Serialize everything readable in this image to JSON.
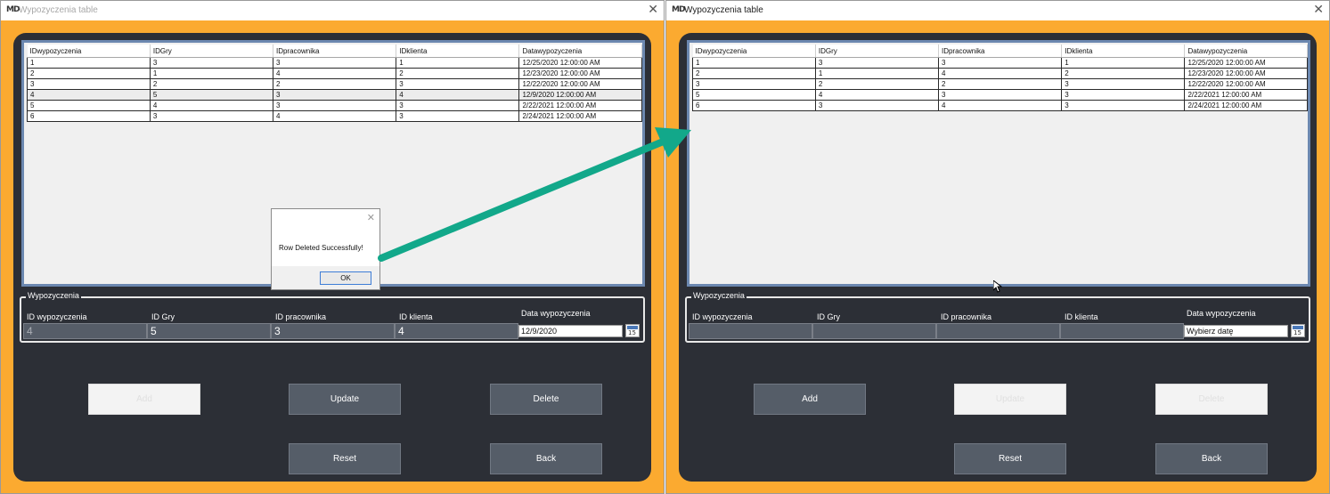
{
  "left": {
    "title": "Wypozyczenia table",
    "app_icon": "MD",
    "columns": [
      "IDwypozyczenia",
      "IDGry",
      "IDpracownika",
      "IDklienta",
      "Datawypozyczenia"
    ],
    "rows": [
      [
        "1",
        "3",
        "3",
        "1",
        "12/25/2020 12:00:00 AM"
      ],
      [
        "2",
        "1",
        "4",
        "2",
        "12/23/2020 12:00:00 AM"
      ],
      [
        "3",
        "2",
        "2",
        "3",
        "12/22/2020 12:00:00 AM"
      ],
      [
        "4",
        "5",
        "3",
        "4",
        "12/9/2020 12:00:00 AM"
      ],
      [
        "5",
        "4",
        "3",
        "3",
        "2/22/2021 12:00:00 AM"
      ],
      [
        "6",
        "3",
        "4",
        "3",
        "2/24/2021 12:00:00 AM"
      ]
    ],
    "group_title": "Wypozyczenia",
    "labels": {
      "id_wypozyczenia": "ID wypozyczenia",
      "id_gry": "ID Gry",
      "id_pracownika": "ID pracownika",
      "id_klienta": "ID klienta",
      "data_wypozyczenia": "Data wypozyczenia"
    },
    "fields": {
      "id_wypozyczenia": "4",
      "id_gry": "5",
      "id_pracownika": "3",
      "id_klienta": "4",
      "date": "12/9/2020"
    },
    "calendar_day": "15",
    "buttons": {
      "add": "Add",
      "update": "Update",
      "delete": "Delete",
      "reset": "Reset",
      "back": "Back"
    },
    "dialog": {
      "message": "Row Deleted Successfully!",
      "ok": "OK"
    }
  },
  "right": {
    "title": "Wypozyczenia table",
    "app_icon": "MD",
    "columns": [
      "IDwypozyczenia",
      "IDGry",
      "IDpracownika",
      "IDklienta",
      "Datawypozyczenia"
    ],
    "rows": [
      [
        "1",
        "3",
        "3",
        "1",
        "12/25/2020 12:00:00 AM"
      ],
      [
        "2",
        "1",
        "4",
        "2",
        "12/23/2020 12:00:00 AM"
      ],
      [
        "3",
        "2",
        "2",
        "3",
        "12/22/2020 12:00:00 AM"
      ],
      [
        "5",
        "4",
        "3",
        "3",
        "2/22/2021 12:00:00 AM"
      ],
      [
        "6",
        "3",
        "4",
        "3",
        "2/24/2021 12:00:00 AM"
      ]
    ],
    "group_title": "Wypozyczenia",
    "labels": {
      "id_wypozyczenia": "ID wypozyczenia",
      "id_gry": "ID Gry",
      "id_pracownika": "ID pracownika",
      "id_klienta": "ID klienta",
      "data_wypozyczenia": "Data wypozyczenia"
    },
    "fields": {
      "id_wypozyczenia": "",
      "id_gry": "",
      "id_pracownika": "",
      "id_klienta": "",
      "date": "Wybierz datę"
    },
    "calendar_day": "15",
    "buttons": {
      "add": "Add",
      "update": "Update",
      "delete": "Delete",
      "reset": "Reset",
      "back": "Back"
    }
  },
  "colors": {
    "orange_frame": "#fbaa30",
    "panel": "#2c2f36",
    "button": "#555d68",
    "arrow": "#12a88a",
    "grid_border": "#6c88b0"
  }
}
